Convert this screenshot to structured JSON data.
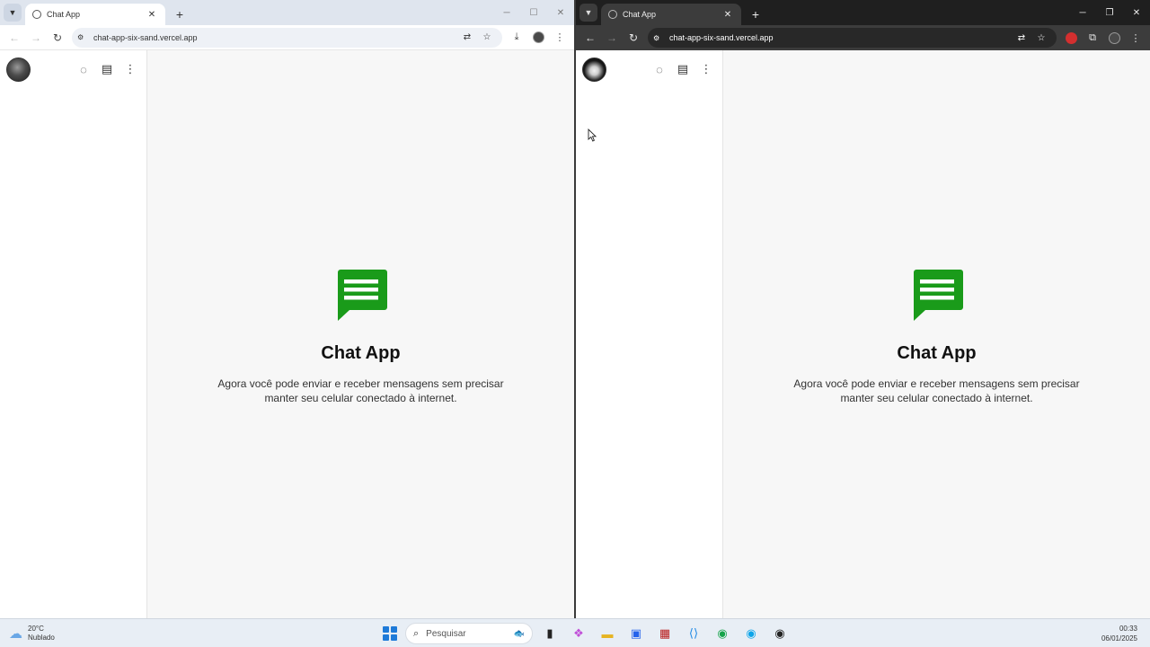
{
  "left_window": {
    "tab_title": "Chat App",
    "url": "chat-app-six-sand.vercel.app"
  },
  "right_window": {
    "tab_title": "Chat App",
    "url": "chat-app-six-sand.vercel.app"
  },
  "app": {
    "title": "Chat App",
    "description": "Agora você pode enviar e receber mensagens sem precisar manter seu celular conectado à internet.",
    "logo_color": "#1a9b1a",
    "sidebar_icons": [
      "status-icon",
      "new-chat-icon",
      "menu-icon"
    ]
  },
  "icons": {
    "tab_menu": "chevron-down-icon",
    "new_tab": "plus-icon",
    "back": "arrow-left-icon",
    "forward": "arrow-right-icon",
    "reload": "reload-icon",
    "translate": "translate-icon",
    "bookmark": "star-icon",
    "download": "download-icon"
  },
  "taskbar": {
    "weather_temp": "20°C",
    "weather_desc": "Nublado",
    "search_placeholder": "Pesquisar",
    "time": "00:33",
    "date": "06/01/2025"
  }
}
